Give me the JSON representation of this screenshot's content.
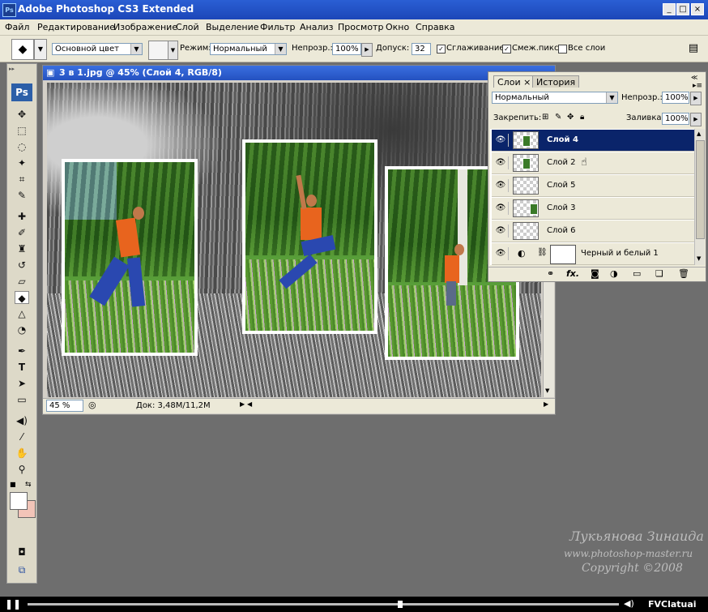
{
  "app": {
    "title": "Adobe Photoshop CS3 Extended",
    "icon": "Ps",
    "min": "_",
    "max": "□",
    "close": "×"
  },
  "menu": [
    "Файл",
    "Редактирование",
    "Изображение",
    "Слой",
    "Выделение",
    "Фильтр",
    "Анализ",
    "Просмотр",
    "Окно",
    "Справка"
  ],
  "options": {
    "fill_source": "Основной цвет",
    "mode_label": "Режим:",
    "mode_value": "Нормальный",
    "opacity_label": "Непрозр.:",
    "opacity_value": "100%",
    "tolerance_label": "Допуск:",
    "tolerance_value": "32",
    "antialias_label": "Сглаживание",
    "contiguous_label": "Смеж.пикс",
    "all_layers_label": "Все слои",
    "antialias_checked": true,
    "contiguous_checked": true,
    "all_layers_checked": false
  },
  "toolbox": {
    "badge": "Ps"
  },
  "document": {
    "title": "3 в 1.jpg @ 45% (Слой 4, RGB/8)",
    "zoom": "45 %",
    "doc_size": "Док: 3,48M/11,2M"
  },
  "layers_panel": {
    "tab_layers": "Слои",
    "tab_close": "×",
    "tab_history": "История",
    "blend_mode": "Нормальный",
    "opacity_label": "Непрозр.:",
    "opacity_value": "100%",
    "lock_label": "Закрепить:",
    "fill_label": "Заливка:",
    "fill_value": "100%",
    "layers": [
      {
        "name": "Слой 4",
        "selected": true
      },
      {
        "name": "Слой 2",
        "selected": false
      },
      {
        "name": "Слой 5",
        "selected": false
      },
      {
        "name": "Слой 3",
        "selected": false
      },
      {
        "name": "Слой 6",
        "selected": false
      },
      {
        "name": "Черный и белый 1",
        "selected": false
      }
    ],
    "footer_fx": "fx."
  },
  "watermark": {
    "author": "Лукьянова Зинаида",
    "site": "www.photoshop-master.ru",
    "copyright": "Copyright ©2008"
  },
  "player": {
    "progress": 0.63,
    "brand": "FVClatuai"
  }
}
